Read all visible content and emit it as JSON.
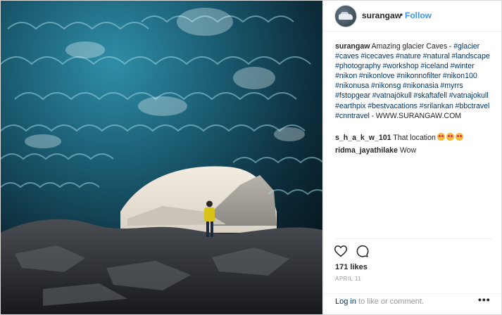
{
  "post": {
    "username": "surangaw",
    "separator": "•",
    "follow_label": "Follow",
    "caption": {
      "user": "surangaw",
      "text_parts": [
        {
          "t": " Amazing glacier Caves - ",
          "tag": false
        },
        {
          "t": "#glacier",
          "tag": true
        },
        {
          "t": " ",
          "tag": false
        },
        {
          "t": "#caves",
          "tag": true
        },
        {
          "t": " ",
          "tag": false
        },
        {
          "t": "#icecaves",
          "tag": true
        },
        {
          "t": " ",
          "tag": false
        },
        {
          "t": "#nature",
          "tag": true
        },
        {
          "t": " ",
          "tag": false
        },
        {
          "t": "#natural",
          "tag": true
        },
        {
          "t": " ",
          "tag": false
        },
        {
          "t": "#landscape",
          "tag": true
        },
        {
          "t": " ",
          "tag": false
        },
        {
          "t": "#photography",
          "tag": true
        },
        {
          "t": " ",
          "tag": false
        },
        {
          "t": "#workshop",
          "tag": true
        },
        {
          "t": " ",
          "tag": false
        },
        {
          "t": "#iceland",
          "tag": true
        },
        {
          "t": " ",
          "tag": false
        },
        {
          "t": "#winter",
          "tag": true
        },
        {
          "t": " ",
          "tag": false
        },
        {
          "t": "#nikon",
          "tag": true
        },
        {
          "t": " ",
          "tag": false
        },
        {
          "t": "#nikonlove",
          "tag": true
        },
        {
          "t": " ",
          "tag": false
        },
        {
          "t": "#nikonnofilter",
          "tag": true
        },
        {
          "t": " ",
          "tag": false
        },
        {
          "t": "#nikon100",
          "tag": true
        },
        {
          "t": " ",
          "tag": false
        },
        {
          "t": "#nikonusa",
          "tag": true
        },
        {
          "t": " ",
          "tag": false
        },
        {
          "t": "#nikonsg",
          "tag": true
        },
        {
          "t": " ",
          "tag": false
        },
        {
          "t": "#nikonasia",
          "tag": true
        },
        {
          "t": " ",
          "tag": false
        },
        {
          "t": "#myrrs",
          "tag": true
        },
        {
          "t": " ",
          "tag": false
        },
        {
          "t": "#fstopgear",
          "tag": true
        },
        {
          "t": " ",
          "tag": false
        },
        {
          "t": "#vatnajökull",
          "tag": true
        },
        {
          "t": " ",
          "tag": false
        },
        {
          "t": "#skaftafell",
          "tag": true
        },
        {
          "t": " ",
          "tag": false
        },
        {
          "t": "#vatnajokull",
          "tag": true
        },
        {
          "t": " ",
          "tag": false
        },
        {
          "t": "#earthpix",
          "tag": true
        },
        {
          "t": " ",
          "tag": false
        },
        {
          "t": "#bestvacations",
          "tag": true
        },
        {
          "t": " ",
          "tag": false
        },
        {
          "t": "#srilankan",
          "tag": true
        },
        {
          "t": " ",
          "tag": false
        },
        {
          "t": "#bbctravel",
          "tag": true
        },
        {
          "t": " ",
          "tag": false
        },
        {
          "t": "#cnntravel",
          "tag": true
        },
        {
          "t": " - WWW.SURANGAW.COM",
          "tag": false
        }
      ]
    },
    "comments": [
      {
        "user": "s_h_a_k_w_101",
        "text": " That location",
        "emoji_count": 3,
        "emoji_name": "heart-eyes-emoji"
      },
      {
        "user": "ridma_jayathilake",
        "text": " Wow",
        "emoji_count": 0
      }
    ],
    "likes": "171 likes",
    "date": "APRIL 11",
    "footer": {
      "login": "Log in",
      "rest": " to like or comment.",
      "more": "•••"
    },
    "icons": {
      "like": "heart-icon",
      "comment": "comment-bubble-icon",
      "more": "more-options-icon"
    },
    "colors": {
      "link": "#003569",
      "follow": "#3897f0",
      "muted": "#999999"
    }
  }
}
